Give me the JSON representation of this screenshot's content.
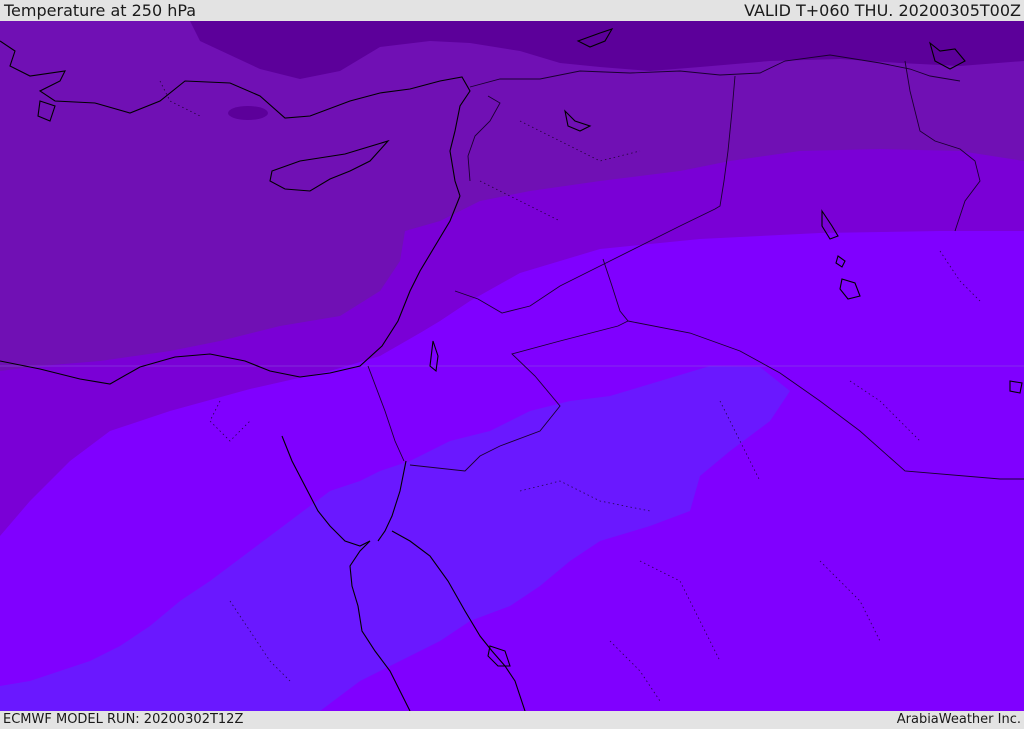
{
  "header": {
    "title": "Temperature at 250 hPa",
    "valid_time": "VALID T+060 THU. 20200305T00Z"
  },
  "footer": {
    "model_run": "ECMWF MODEL RUN: 20200302T12Z",
    "credit": "ArabiaWeather Inc."
  },
  "map": {
    "colors": {
      "coldest": "#5c009a",
      "cold": "#7010b4",
      "cool": "#7a00d6",
      "mid": "#8000ff",
      "warm": "#6a18ff",
      "coastline": "#000000",
      "border": "#1a0030"
    }
  }
}
